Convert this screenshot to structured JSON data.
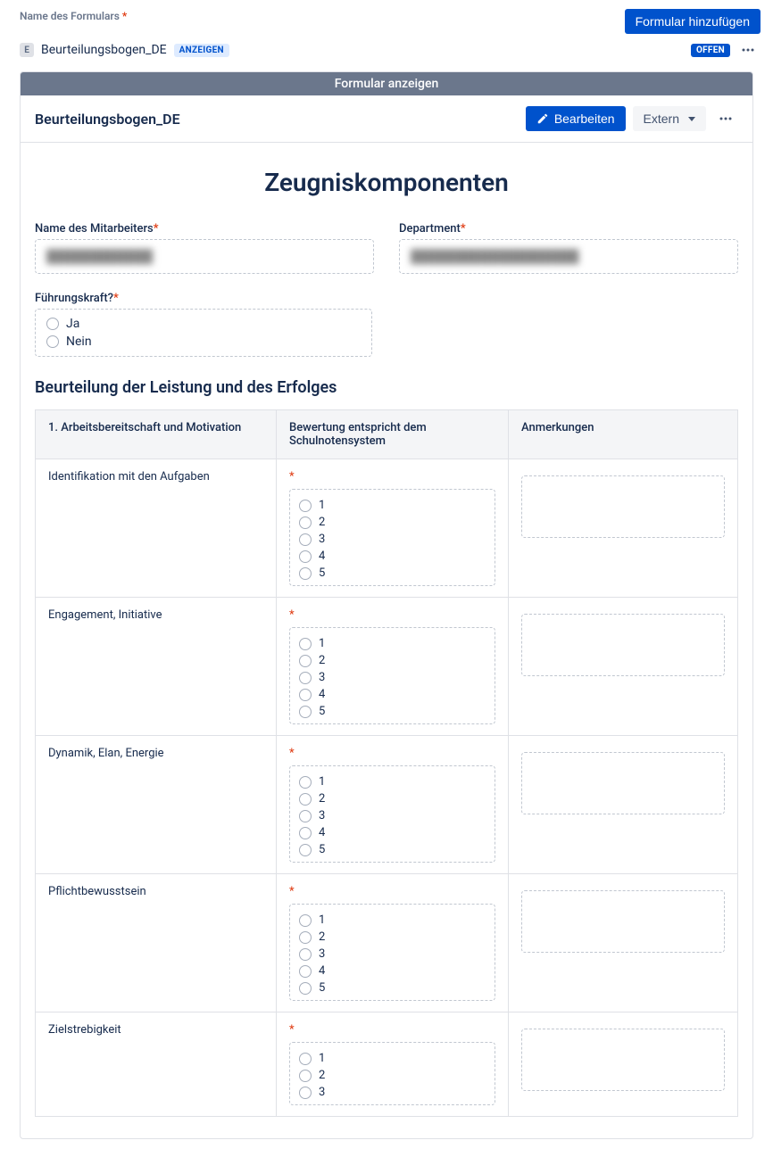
{
  "top": {
    "form_name_label": "Name des Formulars",
    "add_form_button": "Formular hinzufügen",
    "inline_badge_letter": "E",
    "form_name_value": "Beurteilungsbogen_DE",
    "anzeigen_badge": "ANZEIGEN",
    "offn_badge": "OFFEN"
  },
  "panel": {
    "gray_bar": "Formular anzeigen",
    "title": "Beurteilungsbogen_DE",
    "edit_button": "Bearbeiten",
    "extern_button": "Extern"
  },
  "form": {
    "big_title": "Zeugniskomponenten",
    "employee_label": "Name des Mitarbeiters",
    "employee_value": "████████████",
    "department_label": "Department",
    "department_value": "███████████████████",
    "fuehrungskraft_label": "Führungskraft?",
    "fuehrungskraft_options": [
      "Ja",
      "Nein"
    ],
    "section1_heading": "Beurteilung der Leistung und des Erfolges"
  },
  "table": {
    "col1": "1. Arbeitsbereitschaft und Motivation",
    "col2": "Bewertung entspricht dem Schulnotensystem",
    "col3": "Anmerkungen",
    "rating_options": [
      "1",
      "2",
      "3",
      "4",
      "5"
    ],
    "rows": [
      {
        "label": "Identifikation mit den Aufgaben"
      },
      {
        "label": "Engagement, Initiative"
      },
      {
        "label": "Dynamik, Elan, Energie"
      },
      {
        "label": "Pflichtbewusstsein"
      },
      {
        "label": "Zielstrebigkeit"
      }
    ]
  }
}
